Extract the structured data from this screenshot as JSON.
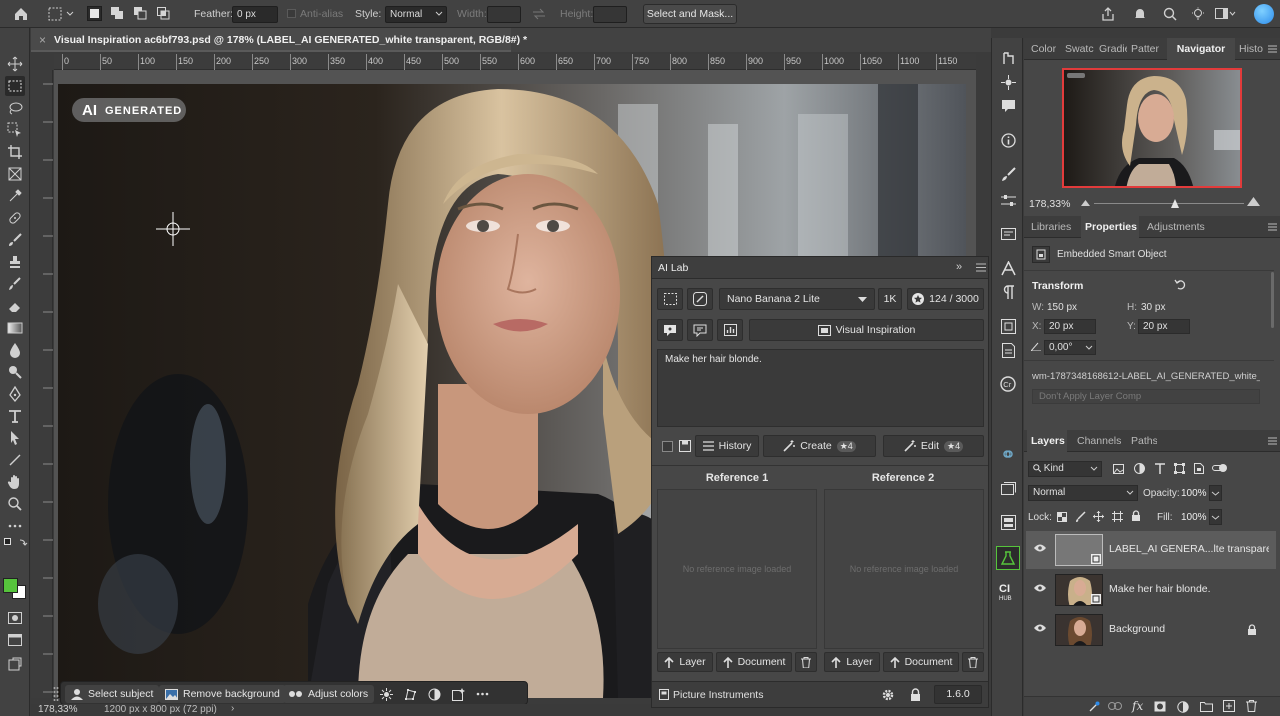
{
  "options_bar": {
    "feather_label": "Feather:",
    "feather_value": "0 px",
    "antialias_label": "Anti-alias",
    "style_label": "Style:",
    "style_value": "Normal",
    "width_label": "Width:",
    "height_label": "Height:",
    "select_mask_label": "Select and Mask..."
  },
  "document": {
    "tab_title": "Visual Inspiration ac6bf793.psd @ 178% (LABEL_AI GENERATED_white transparent, RGB/8#) *",
    "close_glyph": "×",
    "watermark_ai": "AI",
    "watermark_generated": "GENERATED",
    "zoom": "178,33%",
    "doc_size": "1200 px x 800 px (72 ppi)",
    "ruler_ticks": [
      "0",
      "50",
      "100",
      "150",
      "200",
      "250",
      "300",
      "350",
      "400",
      "450",
      "500",
      "550",
      "600",
      "650",
      "700",
      "750",
      "800",
      "850",
      "900",
      "950",
      "1000",
      "1050",
      "1100",
      "1150"
    ]
  },
  "context_bar": {
    "select_subject": "Select subject",
    "remove_background": "Remove background",
    "adjust_colors": "Adjust colors"
  },
  "ai_lab": {
    "title": "AI Lab",
    "model": "Nano Banana 2 Lite",
    "resolution": "1K",
    "credits": "124 / 3000",
    "visual_inspiration": "Visual Inspiration",
    "prompt": "Make her hair blonde.",
    "history": "History",
    "create": "Create",
    "create_cost": "★4",
    "edit": "Edit",
    "edit_cost": "★4",
    "ref1_title": "Reference 1",
    "ref2_title": "Reference 2",
    "no_ref": "No reference image loaded",
    "layer_btn": "Layer",
    "document_btn": "Document",
    "picture_instruments": "Picture Instruments",
    "version": "1.6.0"
  },
  "right_panel": {
    "top_tabs": [
      "Color",
      "Swatc",
      "Gradie",
      "Patter",
      "Navigator",
      "Histo"
    ],
    "nav_zoom": "178,33%",
    "prop_tabs": [
      "Libraries",
      "Properties",
      "Adjustments"
    ],
    "object_type": "Embedded Smart Object",
    "transform_title": "Transform",
    "w_label": "W:",
    "w_value": "150 px",
    "h_label": "H:",
    "h_value": "30 px",
    "x_label": "X:",
    "x_value": "20 px",
    "y_label": "Y:",
    "y_value": "20 px",
    "angle_value": "0,00°",
    "linked_file": "wm-1787348168612-LABEL_AI_GENERATED_white_tr...",
    "layer_comp": "Don't Apply Layer Comp",
    "layer_tabs": [
      "Layers",
      "Channels",
      "Paths"
    ],
    "kind": "Kind",
    "blend_mode": "Normal",
    "opacity_label": "Opacity:",
    "opacity_value": "100%",
    "lock_label": "Lock:",
    "fill_label": "Fill:",
    "fill_value": "100%",
    "layers": [
      {
        "name": "LABEL_AI GENERA...lte transparent"
      },
      {
        "name": "Make her hair blonde."
      },
      {
        "name": "Background"
      }
    ]
  },
  "colors": {
    "accent_green": "#56c43c",
    "navigator_frame": "#e23b3b",
    "app_blue": "#2d8ceb"
  }
}
